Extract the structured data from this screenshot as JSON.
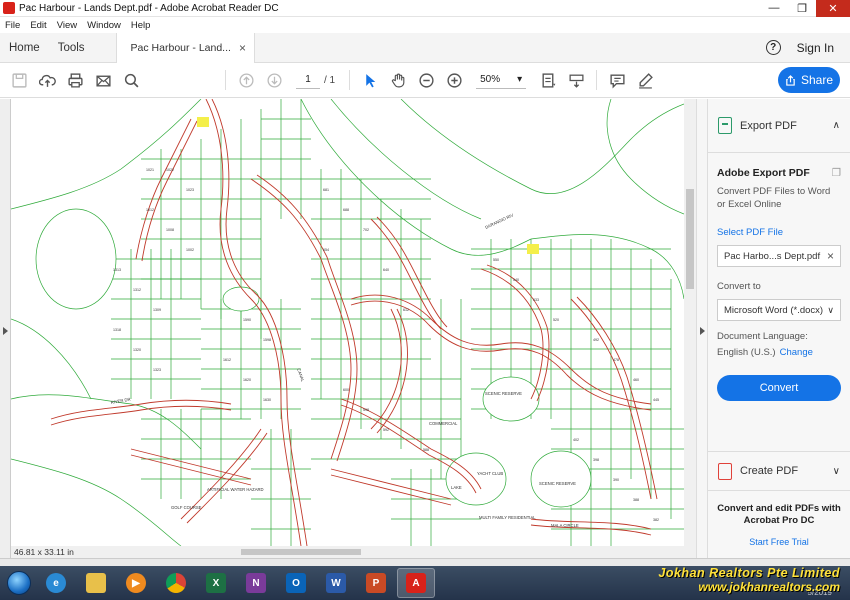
{
  "window": {
    "title": "Pac Harbour - Lands Dept.pdf - Adobe Acrobat Reader DC",
    "minimize": "—",
    "restore": "❐",
    "close": "✕"
  },
  "menu": [
    "File",
    "Edit",
    "View",
    "Window",
    "Help"
  ],
  "tabs": {
    "home": "Home",
    "tools": "Tools",
    "document": "Pac Harbour - Land...",
    "close": "×",
    "help": "?",
    "signin": "Sign In"
  },
  "toolbar": {
    "page_current": "1",
    "page_total": "/ 1",
    "zoom": "50%",
    "zoom_caret": "▾",
    "share": "Share"
  },
  "document": {
    "dimensions": "46.81 x 33.11 in"
  },
  "panel": {
    "export_title": "Export PDF",
    "collapse": "∧",
    "heading": "Adobe Export PDF",
    "description": "Convert PDF Files to Word or Excel Online",
    "select_file": "Select PDF File",
    "selected_file": "Pac Harbo...s Dept.pdf",
    "remove": "×",
    "convert_to_label": "Convert to",
    "convert_to_value": "Microsoft Word (*.docx)",
    "convert_caret": "∨",
    "language_label": "Document Language:",
    "language_value": "English (U.S.)",
    "language_change": "Change",
    "convert_button": "Convert",
    "create_title": "Create PDF",
    "expand": "∨",
    "promo": "Convert and edit PDFs with Acrobat Pro DC",
    "trial": "Start Free Trial"
  },
  "map_labels": {
    "river": "RIVER DR",
    "golf": "GOLF COURSE",
    "artificial": "ARTIFICIAL WATER HAZARD",
    "commercial": "COMMERCIAL",
    "yacht": "YACHT CLUB",
    "scenic1": "SCENIC RESERVE",
    "scenic2": "SCENIC RESERVE",
    "lake": "LAKE",
    "multi": "MULTI FAMILY RESIDENTIAL",
    "canal": "CANAL",
    "dananqio": "DARANGIO RIV",
    "mala": "MALA CIRCLE"
  },
  "watermark": {
    "line1": "Jokhan Realtors Pte Limited",
    "line2": "www.jokhanrealtors.com"
  },
  "taskbar": {
    "date": "5/2019"
  },
  "colors": {
    "accent": "#1473e6",
    "map_road": "#c0392b",
    "map_lot": "#27ae3c"
  }
}
